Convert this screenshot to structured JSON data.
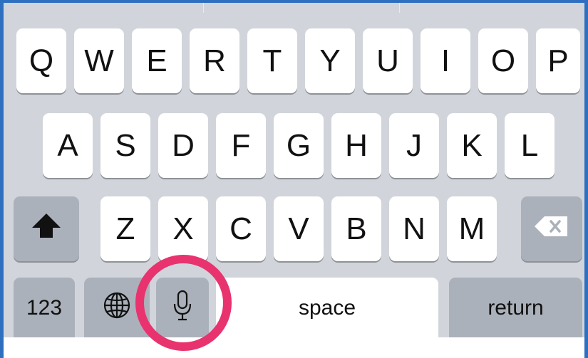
{
  "keyboard": {
    "row1": [
      "Q",
      "W",
      "E",
      "R",
      "T",
      "Y",
      "U",
      "I",
      "O",
      "P"
    ],
    "row2": [
      "A",
      "S",
      "D",
      "F",
      "G",
      "H",
      "J",
      "K",
      "L"
    ],
    "row3": [
      "Z",
      "X",
      "C",
      "V",
      "B",
      "N",
      "M"
    ],
    "numbers_label": "123",
    "space_label": "space",
    "return_label": "return",
    "shift_icon": "shift-arrow-up",
    "backspace_icon": "backspace-x",
    "globe_icon": "globe",
    "mic_icon": "microphone",
    "highlight_color": "#e8336f",
    "accent_color": "#2f6fc0"
  }
}
